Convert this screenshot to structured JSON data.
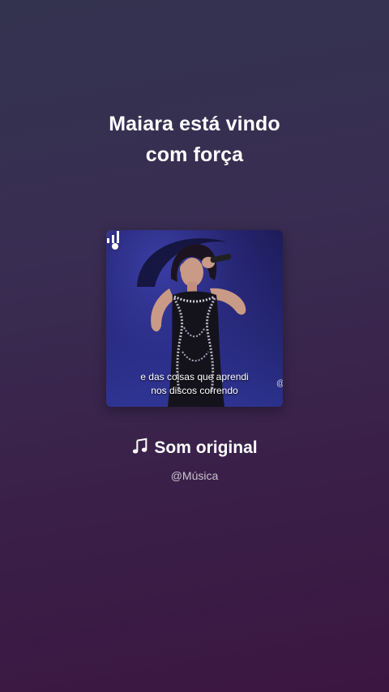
{
  "headline": {
    "line1": "Maiara está vindo",
    "line2": "com força"
  },
  "cover": {
    "caption_line1": "e das coisas que aprendi",
    "caption_line2": "nos discos correndo",
    "at_mark": "@",
    "icon": "audio-bars-icon"
  },
  "sound": {
    "icon": "music-note-icon",
    "title": "Som original",
    "handle": "@Música"
  },
  "colors": {
    "background_top": "#33334f",
    "background_bottom": "#3b1640",
    "text": "#ffffff"
  }
}
